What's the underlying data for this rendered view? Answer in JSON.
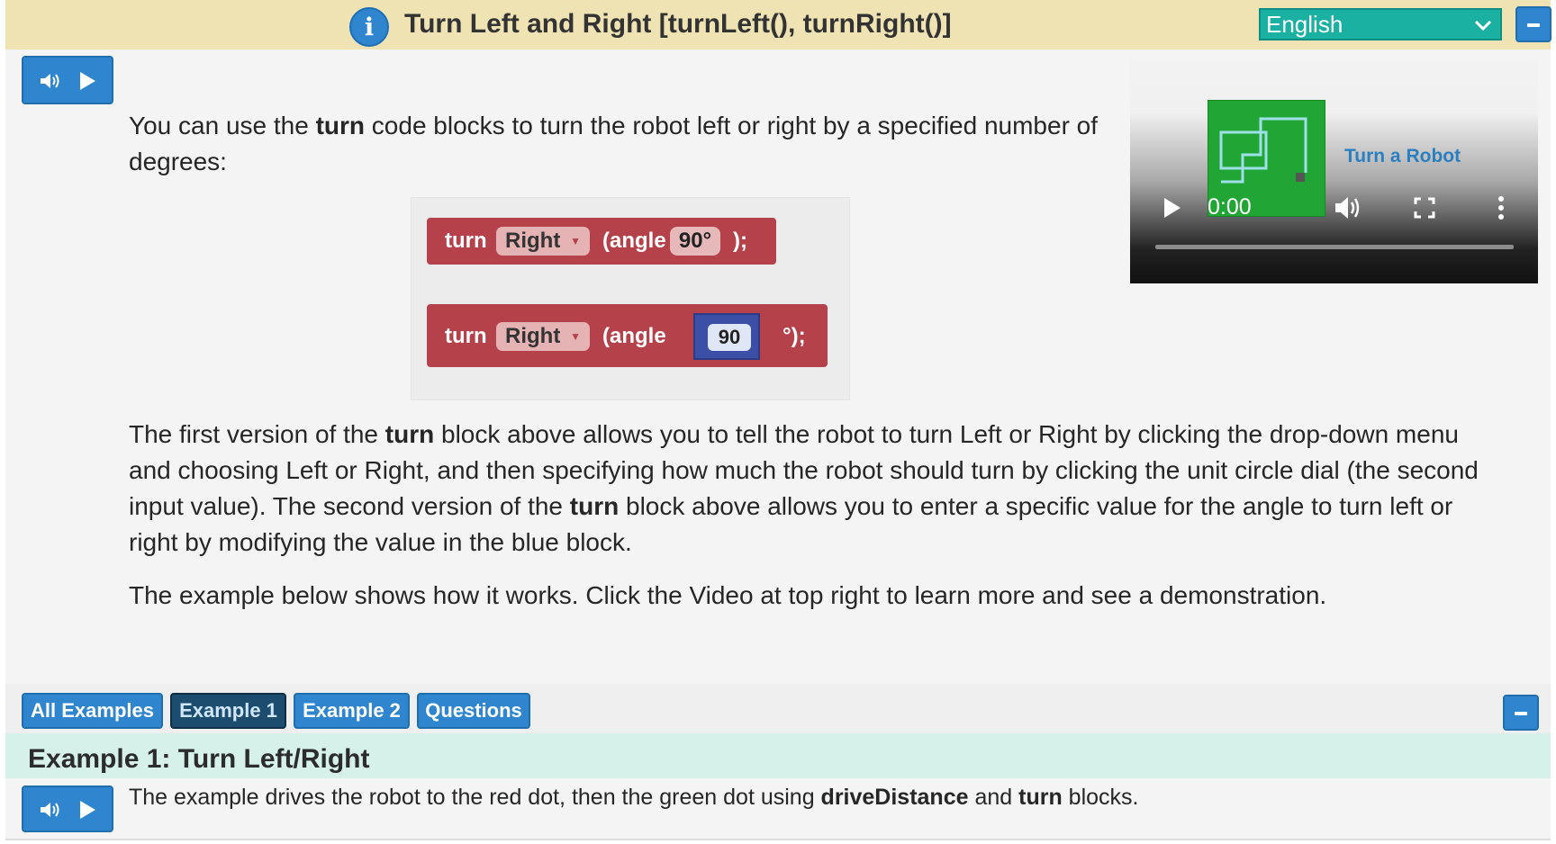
{
  "header": {
    "title": "Turn Left and Right [turnLeft(), turnRight()]",
    "info_icon": "info-icon",
    "language": "English"
  },
  "intro": {
    "line1_pre": "You can use the ",
    "line1_bold": "turn",
    "line1_post": " code blocks to turn the robot left or right by a specified number of",
    "line2": "degrees:"
  },
  "blocks": {
    "block1": {
      "keyword": "turn",
      "direction": "Right",
      "angle_label": "(angle",
      "angle_value": "90°",
      "end": ");"
    },
    "block2": {
      "keyword": "turn",
      "direction": "Right",
      "angle_label": "(angle",
      "angle_value": "90",
      "end": "°);"
    }
  },
  "para2": {
    "l1_pre": "The first version of the ",
    "l1_bold": "turn",
    "l1_post": " block above allows you to tell the robot to turn Left or Right by clicking the drop-down menu",
    "l2": "and choosing Left or Right, and then specifying how much the robot should turn by clicking the unit circle dial (the second",
    "l3_pre": "input value). The second version of the ",
    "l3_bold": "turn",
    "l3_post": " block above allows you to enter a specific value for the angle to turn left or",
    "l4": "right by modifying the value in the blue block."
  },
  "para3": "The example below shows how it works. Click the Video at top right to learn more and see a demonstration.",
  "video": {
    "title": "Turn a Robot",
    "time": "0:00"
  },
  "tabs": [
    "All Examples",
    "Example 1",
    "Example 2",
    "Questions"
  ],
  "active_tab": "Example 1",
  "example": {
    "title": "Example 1: Turn Left/Right",
    "desc_pre": "The example drives the robot to the red dot, then the green dot using ",
    "desc_bold1": "driveDistance",
    "desc_mid": " and ",
    "desc_bold2": "turn",
    "desc_post": " blocks."
  },
  "colors": {
    "header_bg": "#efe3b4",
    "button_blue": "#2f86cf",
    "select_teal": "#1ab0a2",
    "block_red": "#b5414b",
    "example_bg": "#d6f0ea"
  }
}
